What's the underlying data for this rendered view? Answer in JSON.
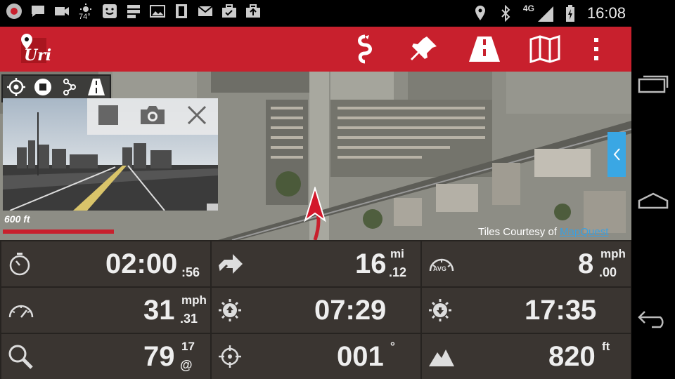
{
  "status_bar": {
    "weather_temp": "74°",
    "network": "4G",
    "time": "16:08"
  },
  "app": {
    "logo_text": "Uri",
    "action_icons": [
      "route-icon",
      "pin-icon",
      "road-icon",
      "map-icon",
      "overflow-icon"
    ]
  },
  "map": {
    "scale_label": "600 ft",
    "attribution_prefix": "Tiles Courtesy of ",
    "attribution_link": "MapQuest"
  },
  "dashboard": {
    "rows": [
      [
        {
          "icon": "stopwatch-icon",
          "big": "02:00",
          "sup": "",
          "sub": ":56"
        },
        {
          "icon": "distance-icon",
          "big": "16",
          "sup": "mi",
          "sub": ".12"
        },
        {
          "icon": "avg-speed-icon",
          "big": "8",
          "sup": "mph",
          "sub": ".00",
          "icon_label": "AVG"
        }
      ],
      [
        {
          "icon": "speedometer-icon",
          "big": "31",
          "sup": "mph",
          "sub": ".31"
        },
        {
          "icon": "sunrise-icon",
          "big": "07:29",
          "sup": "",
          "sub": ""
        },
        {
          "icon": "sunset-icon",
          "big": "17:35",
          "sup": "",
          "sub": ""
        }
      ],
      [
        {
          "icon": "satellite-search-icon",
          "big": "79",
          "sup": "17",
          "sub": "@"
        },
        {
          "icon": "bearing-icon",
          "big": "001",
          "sup": "°",
          "sub": ""
        },
        {
          "icon": "altitude-icon",
          "big": "820",
          "sup": "ft",
          "sub": ""
        }
      ]
    ]
  }
}
